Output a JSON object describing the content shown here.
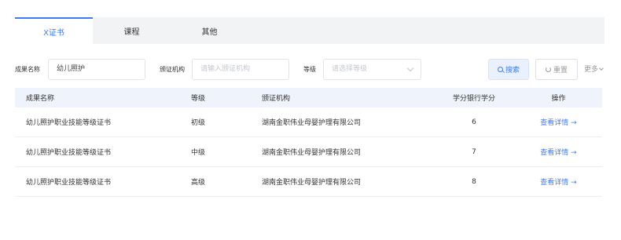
{
  "tabs": [
    {
      "label": "X证书",
      "active": true
    },
    {
      "label": "课程",
      "active": false
    },
    {
      "label": "其他",
      "active": false
    }
  ],
  "filters": {
    "name_label": "成果名称",
    "name_value": "幼儿照护",
    "org_label": "颁证机构",
    "org_placeholder": "请输入颁证机构",
    "level_label": "等级",
    "level_placeholder": "请选择等级",
    "search_label": "搜索",
    "reset_label": "重置",
    "more_label": "更多"
  },
  "table": {
    "headers": [
      "成果名称",
      "等级",
      "颁证机构",
      "学分银行学分",
      "操作"
    ],
    "rows": [
      {
        "name": "幼儿照护职业技能等级证书",
        "level": "初级",
        "org": "湖南金职伟业母婴护理有限公司",
        "credits": "6",
        "action": "查看详情 →"
      },
      {
        "name": "幼儿照护职业技能等级证书",
        "level": "中级",
        "org": "湖南金职伟业母婴护理有限公司",
        "credits": "7",
        "action": "查看详情 →"
      },
      {
        "name": "幼儿照护职业技能等级证书",
        "level": "高级",
        "org": "湖南金职伟业母婴护理有限公司",
        "credits": "8",
        "action": "查看详情 →"
      }
    ]
  },
  "colors": {
    "accent": "#3d7cf0",
    "tab_bar_bg": "#f2f3f5",
    "table_header_bg": "#eef3fc"
  },
  "icons": {
    "search": "search-icon",
    "reset": "reset-icon",
    "more": "chevron-down-icon",
    "select": "chevron-down-icon"
  }
}
